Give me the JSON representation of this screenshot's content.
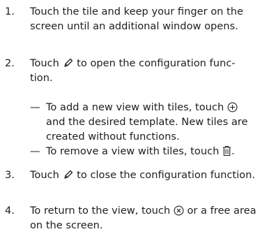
{
  "steps": [
    {
      "number": "1.",
      "parts": [
        "Touch the tile and keep your finger on the screen until an additional window opens."
      ]
    },
    {
      "number": "2.",
      "parts": [
        "Touch",
        "to open the configuration func-tion."
      ],
      "icon": "pencil-icon",
      "subitems": [
        {
          "dash": "—",
          "parts": [
            "To add a new view with tiles, touch",
            "and the desired template. New tiles are created without functions."
          ],
          "icon": "add-circle-icon"
        },
        {
          "dash": "—",
          "parts": [
            "To remove a view with tiles, touch",
            "."
          ],
          "icon": "trash-icon"
        }
      ]
    },
    {
      "number": "3.",
      "parts": [
        "Touch",
        "to close the configuration function."
      ],
      "icon": "pencil-icon"
    },
    {
      "number": "4.",
      "parts": [
        "To return to the view, touch",
        "or a free area on the screen."
      ],
      "icon": "close-circle-icon"
    }
  ]
}
